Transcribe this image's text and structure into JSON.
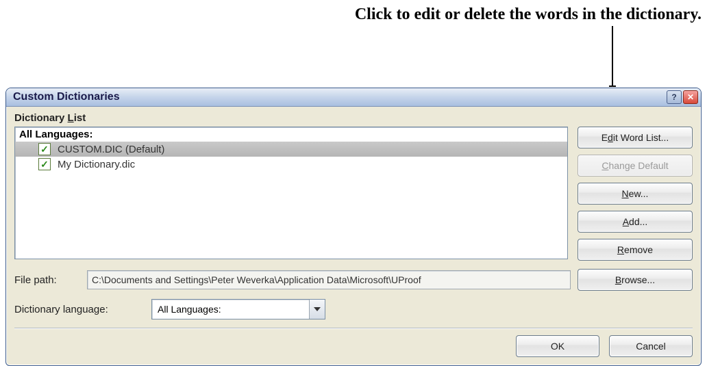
{
  "annotation": "Click to edit or delete the words in the dictionary.",
  "dialog": {
    "title": "Custom Dictionaries",
    "section_label_pre": "Dictionary ",
    "section_label_ul": "L",
    "section_label_post": "ist",
    "group_header": "All Languages:",
    "items": [
      {
        "label": "CUSTOM.DIC (Default)",
        "checked": true,
        "selected": true
      },
      {
        "label": "My Dictionary.dic",
        "checked": true,
        "selected": false
      }
    ],
    "buttons": {
      "edit_pre": "E",
      "edit_ul": "d",
      "edit_post": "it Word List...",
      "change_ul": "C",
      "change_post": "hange Default",
      "new_ul": "N",
      "new_post": "ew...",
      "add_ul": "A",
      "add_post": "dd...",
      "remove_ul": "R",
      "remove_post": "emove",
      "browse_ul": "B",
      "browse_post": "rowse..."
    },
    "file_path_label": "File path:",
    "file_path_value": "C:\\Documents and Settings\\Peter Weverka\\Application Data\\Microsoft\\UProof",
    "lang_label": "Dictionary language:",
    "lang_value": "All Languages:",
    "ok": "OK",
    "cancel": "Cancel"
  }
}
